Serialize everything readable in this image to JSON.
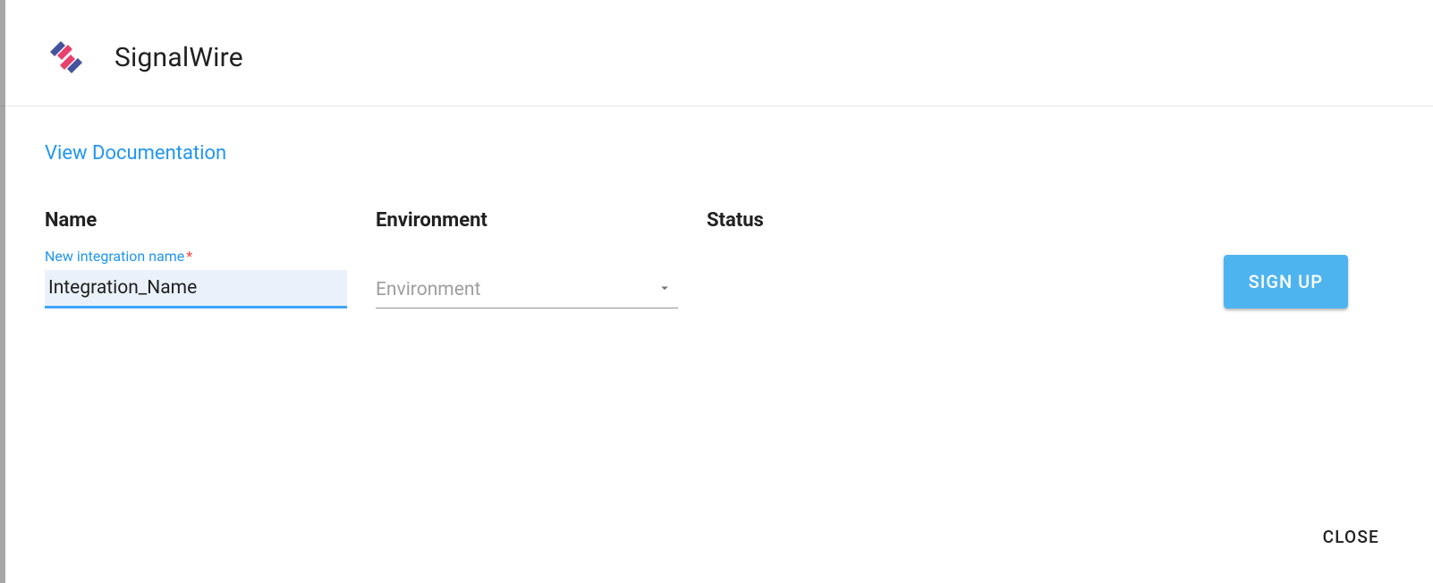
{
  "header": {
    "title": "SignalWire"
  },
  "links": {
    "docs": "View Documentation"
  },
  "columns": {
    "name": "Name",
    "environment": "Environment",
    "status": "Status"
  },
  "form": {
    "name_label": "New integration name",
    "name_required_mark": "*",
    "name_value": "Integration_Name",
    "environment_placeholder": "Environment"
  },
  "buttons": {
    "signup": "SIGN UP",
    "close": "CLOSE"
  },
  "colors": {
    "accent_blue": "#2196f3",
    "button_blue": "#4eb4f0",
    "logo_blue": "#44539d",
    "logo_pink": "#e7426d"
  }
}
